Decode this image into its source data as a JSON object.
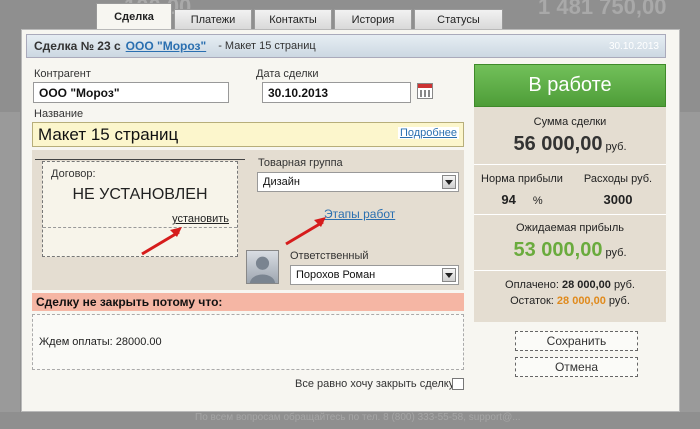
{
  "background": {
    "left_number": "100,00",
    "right_number": "1 481 750,00"
  },
  "tabs": [
    "Сделка",
    "Платежи",
    "Контакты",
    "История",
    "Статусы"
  ],
  "header": {
    "deal": "Сделка № 23 с",
    "company": "ООО \"Мороз\"",
    "subject": "- Макет 15 страниц",
    "date": "30.10.2013"
  },
  "form": {
    "counterparty_label": "Контрагент",
    "counterparty_value": "ООО \"Мороз\"",
    "deal_date_label": "Дата сделки",
    "deal_date_value": "30.10.2013",
    "name_label": "Название",
    "name_value": "Макет 15 страниц",
    "more_link": "Подробнее",
    "product_group_label": "Товарная группа",
    "product_group_value": "Дизайн",
    "responsible_label": "Ответственный",
    "responsible_value": "Порохов Роман",
    "stages_link": "Этапы работ"
  },
  "contract": {
    "title": "Договор:",
    "status": "НЕ УСТАНОВЛЕН",
    "set_link": "установить"
  },
  "reason": {
    "title": "Сделку не закрыть потому что:",
    "text": "Ждем оплаты: 28000.00",
    "close_anyway": "Все равно хочу закрыть сделку"
  },
  "status_panel": {
    "state": "В работе",
    "sum_label": "Сумма сделки",
    "sum_value": "56 000,00",
    "currency": "руб.",
    "profit_rate_label": "Норма прибыли",
    "profit_rate_value": "94",
    "percent": "%",
    "expenses_label": "Расходы руб.",
    "expenses_value": "3000",
    "expected_profit_label": "Ожидаемая прибыль",
    "expected_profit_value": "53 000,00",
    "paid_label": "Оплачено:",
    "paid_value": "28 000,00",
    "remaining_label": "Остаток:",
    "remaining_value": "28 000,00"
  },
  "buttons": {
    "save": "Сохранить",
    "cancel": "Отмена"
  },
  "footer": "По всем вопросам обращайтесь по тел. 8 (800) 333-55-58, support@..."
}
